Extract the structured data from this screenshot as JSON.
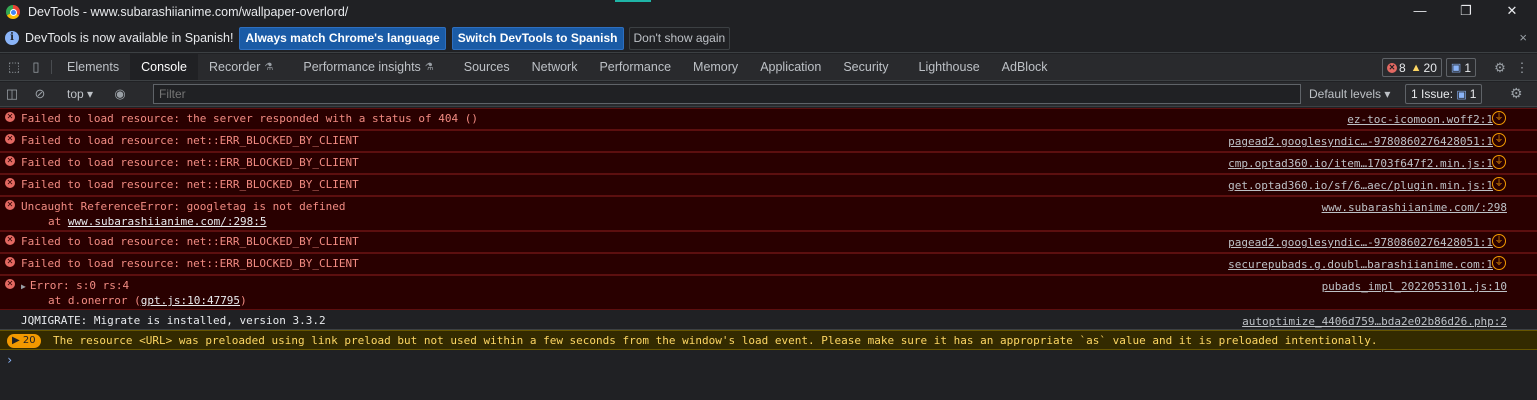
{
  "window": {
    "title": "DevTools - www.subarashiianime.com/wallpaper-overlord/",
    "minimize_glyph": "—",
    "restore_glyph": "❐",
    "close_glyph": "✕"
  },
  "infobar": {
    "message": "DevTools is now available in Spanish!",
    "match_label": "Always match Chrome's language",
    "switch_label": "Switch DevTools to Spanish",
    "dismiss_label": "Don't show again",
    "close_glyph": "×"
  },
  "tabs": [
    {
      "label": "Elements"
    },
    {
      "label": "Console"
    },
    {
      "label": "Recorder"
    },
    {
      "label": "Performance insights"
    },
    {
      "label": "Sources"
    },
    {
      "label": "Network"
    },
    {
      "label": "Performance"
    },
    {
      "label": "Memory"
    },
    {
      "label": "Application"
    },
    {
      "label": "Security"
    },
    {
      "label": "Lighthouse"
    },
    {
      "label": "AdBlock"
    }
  ],
  "counters": {
    "errors": "8",
    "warnings": "20",
    "messages": "1"
  },
  "toolbar": {
    "context": "top",
    "filter_placeholder": "Filter",
    "levels_label": "Default levels",
    "issues_label": "1 Issue:",
    "issues_count": "1"
  },
  "messages": [
    {
      "type": "error",
      "text": "Failed to load resource: the server responded with a status of 404 ()",
      "source": "ez-toc-icomoon.woff2:1"
    },
    {
      "type": "error",
      "text": "Failed to load resource: net::ERR_BLOCKED_BY_CLIENT",
      "source": "pagead2.googlesyndic…-9780860276428051:1"
    },
    {
      "type": "error",
      "text": "Failed to load resource: net::ERR_BLOCKED_BY_CLIENT",
      "source": "cmp.optad360.io/item…1703f647f2.min.js:1"
    },
    {
      "type": "error",
      "text": "Failed to load resource: net::ERR_BLOCKED_BY_CLIENT",
      "source": "get.optad360.io/sf/6…aec/plugin.min.js:1"
    },
    {
      "type": "error",
      "text": "Uncaught ReferenceError: googletag is not defined",
      "stack_prefix": "at ",
      "stack_link": "www.subarashiianime.com/:298:5",
      "source": "www.subarashiianime.com/:298"
    },
    {
      "type": "error",
      "text": "Failed to load resource: net::ERR_BLOCKED_BY_CLIENT",
      "source": "pagead2.googlesyndic…-9780860276428051:1"
    },
    {
      "type": "error",
      "text": "Failed to load resource: net::ERR_BLOCKED_BY_CLIENT",
      "source": "securepubads.g.doubl…barashiianime.com:1"
    },
    {
      "type": "error",
      "text": "Error: s:0 rs:4",
      "stack_prefix": "at d.onerror (",
      "stack_link": "gpt.js:10:47795",
      "stack_suffix": ")",
      "source": "pubads_impl_2022053101.js:10"
    },
    {
      "type": "info",
      "text": "JQMIGRATE: Migrate is installed, version 3.3.2",
      "source": "autoptimize_4406d759…bda2e02b86d26.php:2"
    },
    {
      "type": "warning",
      "count": "20",
      "text": "The resource <URL> was preloaded using link preload but not used within a few seconds from the window's load event. Please make sure it has an appropriate `as` value and it is preloaded intentionally."
    }
  ],
  "colors": {
    "error_bg": "#290000",
    "error_text": "#f28b82",
    "warning_bg": "#332a00",
    "warning_text": "#fdd663",
    "primary_button": "#1a5ba6"
  }
}
